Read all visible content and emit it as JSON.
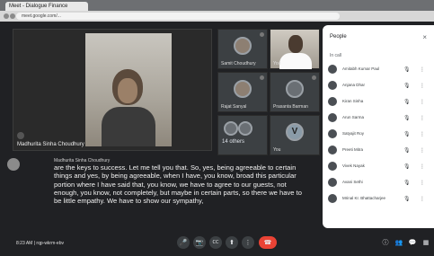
{
  "browser": {
    "tab_title": "Meet - Dialogue Finance",
    "url": "meet.google.com/..."
  },
  "main_tile": {
    "name": "Madhurita Sinha Choudhury"
  },
  "thumbnails": [
    {
      "name": "Samit Choudhury",
      "kind": "avatar"
    },
    {
      "name": "You",
      "kind": "video"
    },
    {
      "name": "Rajat Sanyal",
      "kind": "avatar"
    },
    {
      "name": "Prasanta Barman",
      "kind": "avatar"
    },
    {
      "name": "14 others",
      "kind": "more"
    },
    {
      "name": "You",
      "kind": "initial",
      "initial": "V"
    }
  ],
  "people_panel": {
    "title": "People",
    "close_label": "×",
    "section_label": "In call",
    "items": [
      {
        "name": "Amitabh Kumar Paul"
      },
      {
        "name": "Anjana Dhar"
      },
      {
        "name": "Kiran Sinha"
      },
      {
        "name": "Arun Sarma"
      },
      {
        "name": "Satyajit Roy"
      },
      {
        "name": "Preeti Mitra"
      },
      {
        "name": "Vivek Nayak"
      },
      {
        "name": "Avani Sethi"
      },
      {
        "name": "Mrinal Kr. Bhattacharjee"
      }
    ],
    "mic_icon_glyph": "🎙",
    "more_icon_glyph": "⋮"
  },
  "caption": {
    "speaker": "Madhurita Sinha Choudhury",
    "text": "are the keys to success. Let me tell you that. So, yes, being agreeable to certain things and yes, by being agreeable, when I have, you know, broad this particular portion where I have said that, you know, we have to agree to our guests, not enough, you know, not completely, but maybe in certain parts, so there we have to be little empathy. We have to show our sympathy,"
  },
  "bottom_bar": {
    "time": "8:23 AM",
    "meeting_code": "rqp-wkrm-ebv",
    "time_code": "8:23 AM | rqp-wkrm-ebv",
    "controls": [
      "🎤",
      "📷",
      "CC",
      "⬆",
      "⋮",
      "☎"
    ],
    "right_controls": [
      "ⓘ",
      "👥",
      "💬",
      "▦"
    ]
  },
  "colors": {
    "meet_background": "#202124",
    "panel_background": "#ffffff",
    "hangup": "#ea4335"
  }
}
